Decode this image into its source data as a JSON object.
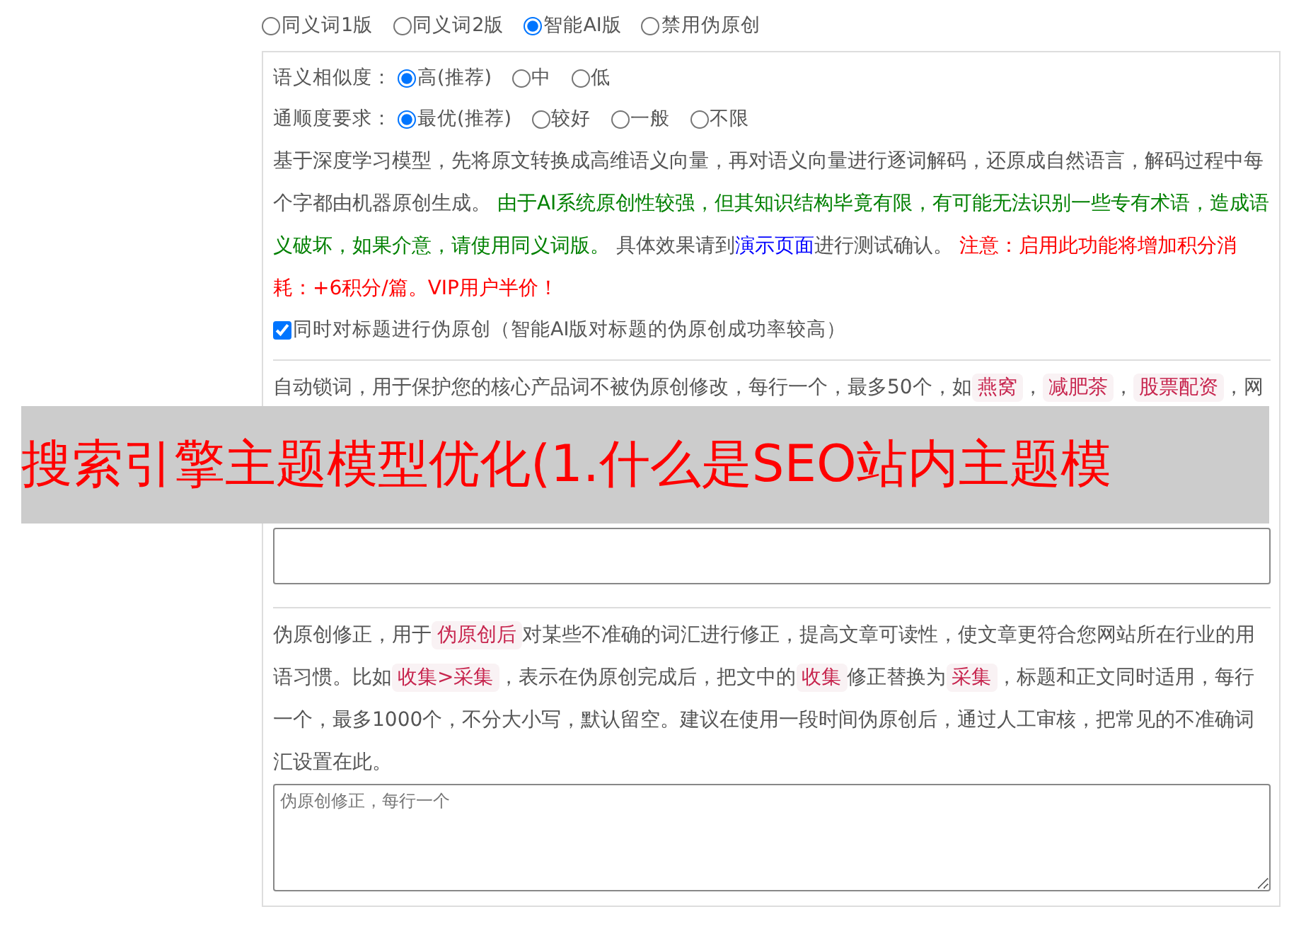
{
  "mode_options": [
    {
      "label": "同义词1版",
      "selected": false
    },
    {
      "label": "同义词2版",
      "selected": false
    },
    {
      "label": "智能AI版",
      "selected": true
    },
    {
      "label": "禁用伪原创",
      "selected": false
    }
  ],
  "ai_settings": {
    "similarity": {
      "label": "语义相似度：",
      "options": [
        {
          "label": "高(推荐)",
          "selected": true
        },
        {
          "label": "中",
          "selected": false
        },
        {
          "label": "低",
          "selected": false
        }
      ]
    },
    "fluency": {
      "label": "通顺度要求：",
      "options": [
        {
          "label": "最优(推荐)",
          "selected": true
        },
        {
          "label": "较好",
          "selected": false
        },
        {
          "label": "一般",
          "selected": false
        },
        {
          "label": "不限",
          "selected": false
        }
      ]
    },
    "description": [
      {
        "kind": "text",
        "text": "基于深度学习模型，先将原文转换成高维语义向量，再对语义向量进行逐词解码，还原成自然语言，解码过程中每个字都由机器原创生成。 "
      },
      {
        "kind": "success",
        "text": "由于AI系统原创性较强，但其知识结构毕竟有限，有可能无法识别一些专有术语，造成语义破坏，如果介意，请使用同义词版。"
      },
      {
        "kind": "text",
        "text": " 具体效果请到"
      },
      {
        "kind": "link",
        "text": "演示页面"
      },
      {
        "kind": "text",
        "text": "进行测试确认。 "
      },
      {
        "kind": "danger",
        "text": "注意：启用此功能将增加积分消耗：+6积分/篇。VIP用户半价！"
      }
    ],
    "title_checkbox": {
      "label": "同时对标题进行伪原创（智能AI版对标题的伪原创成功率较高）",
      "checked": true
    }
  },
  "lock_words": {
    "description": [
      {
        "kind": "text",
        "text": "自动锁词，用于保护您的核心产品词不被伪原创修改，每行一个，最多50个，如"
      },
      {
        "kind": "code",
        "text": "燕窝"
      },
      {
        "kind": "text",
        "text": "，"
      },
      {
        "kind": "code",
        "text": "减肥茶"
      },
      {
        "kind": "text",
        "text": "，"
      },
      {
        "kind": "code",
        "text": "股票配资"
      },
      {
        "kind": "text",
        "text": "，网"
      }
    ]
  },
  "corrections": {
    "description": [
      {
        "kind": "text",
        "text": "伪原创修正，用于"
      },
      {
        "kind": "code",
        "text": "伪原创后"
      },
      {
        "kind": "text",
        "text": "对某些不准确的词汇进行修正，提高文章可读性，使文章更符合您网站所在行业的用语习惯。比如"
      },
      {
        "kind": "code",
        "text": "收集>采集"
      },
      {
        "kind": "text",
        "text": "，表示在伪原创完成后，把文中的"
      },
      {
        "kind": "code",
        "text": "收集"
      },
      {
        "kind": "text",
        "text": "修正替换为"
      },
      {
        "kind": "code",
        "text": "采集"
      },
      {
        "kind": "text",
        "text": "，标题和正文同时适用，每行一个，最多1000个，不分大小写，默认留空。建议在使用一段时间伪原创后，通过人工审核，把常见的不准确词汇设置在此。"
      }
    ],
    "placeholder": "伪原创修正，每行一个"
  },
  "overlay_title": "搜索引擎主题模型优化(1.什么是SEO站内主题模"
}
